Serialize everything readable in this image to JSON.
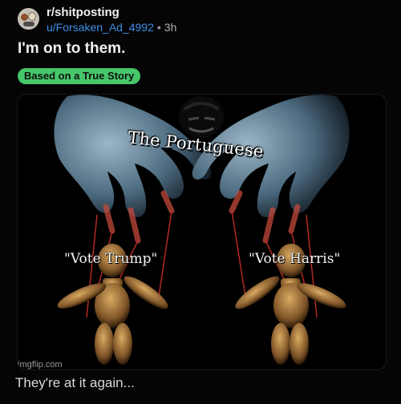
{
  "post": {
    "subreddit": "r/shitposting",
    "username": "u/Forsaken_Ad_4992",
    "separator": "•",
    "age": "3h",
    "title": "I'm on to them.",
    "flair": "Based on a True Story",
    "body_text": "They're at it again..."
  },
  "meme": {
    "top_text": "The Portuguese",
    "left_label": "\"Vote Trump\"",
    "right_label": "\"Vote Harris\"",
    "watermark": "imgflip.com"
  },
  "colors": {
    "background": "#050505",
    "username": "#3d8ee8",
    "flair": "#46c76a"
  }
}
